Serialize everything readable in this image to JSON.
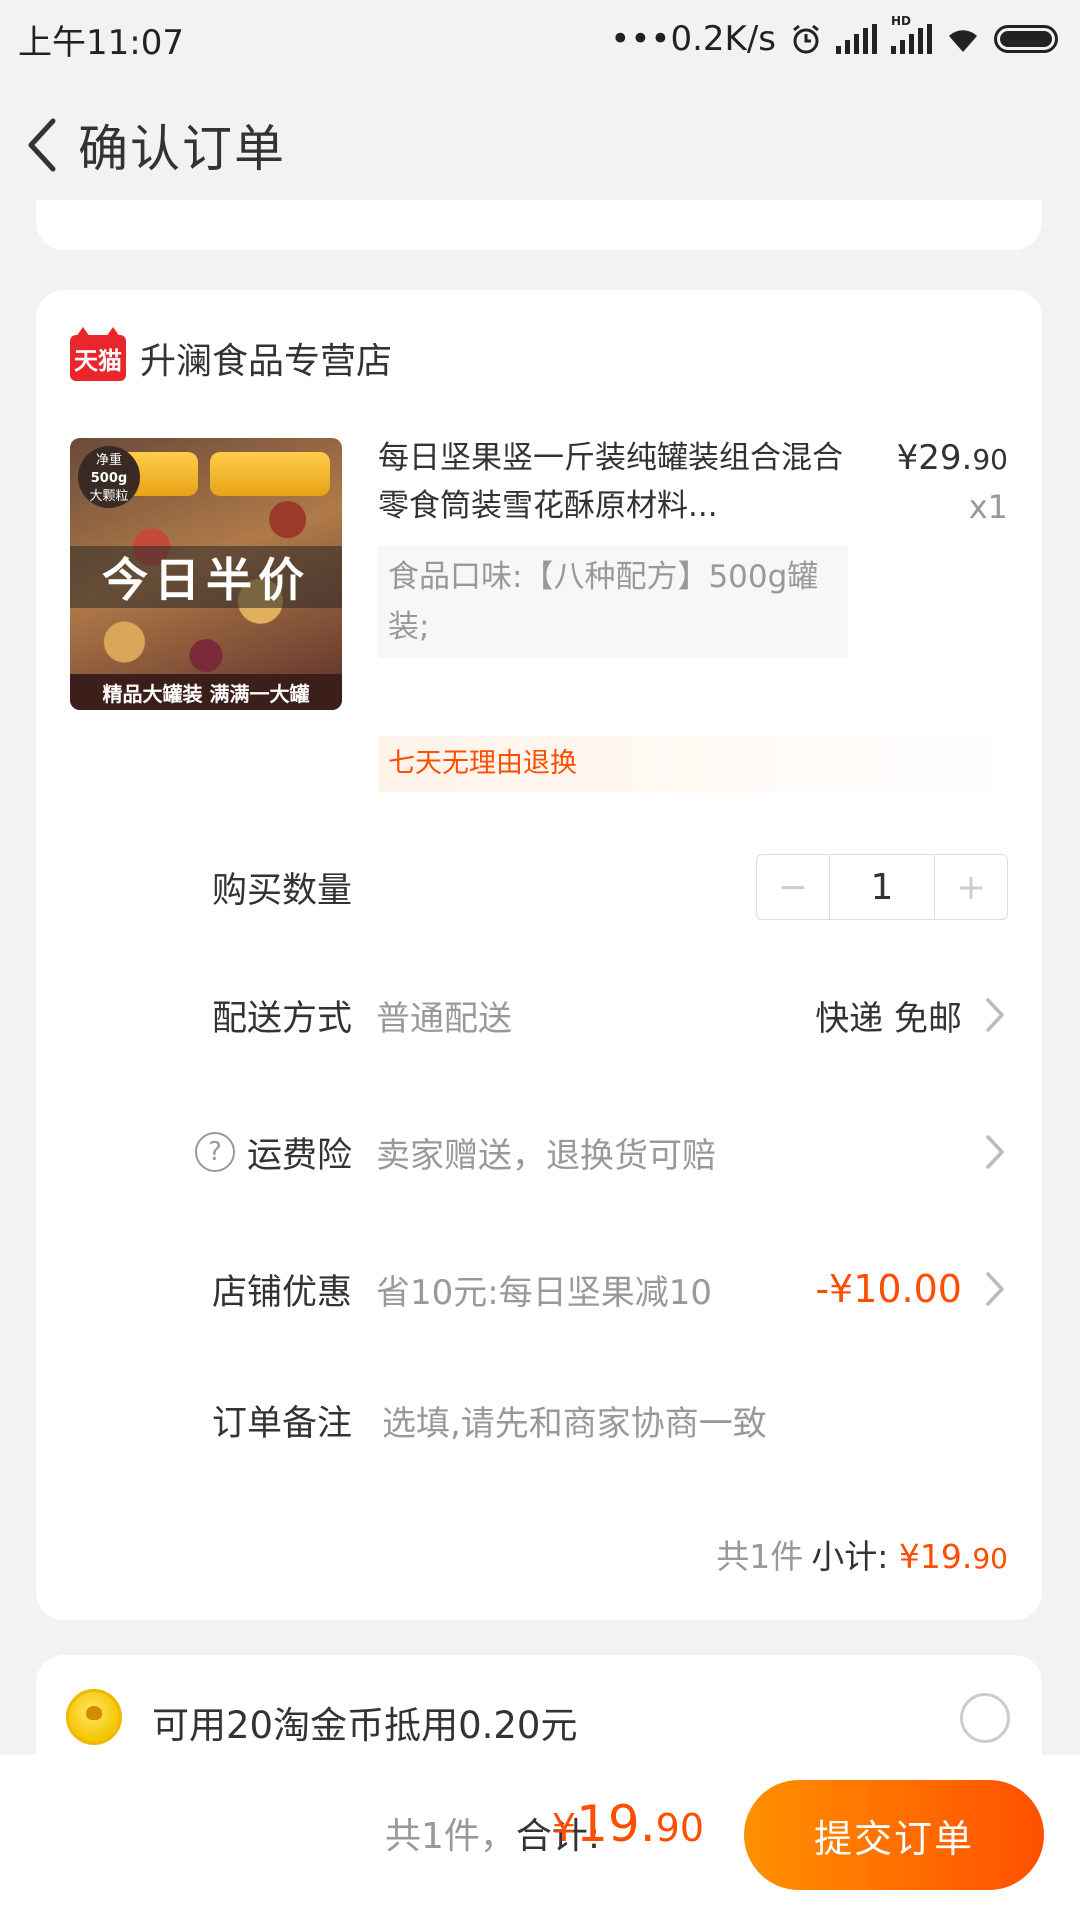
{
  "status_bar": {
    "time": "上午11:07",
    "net_speed": "•••0.2K/s",
    "hd_label": "HD"
  },
  "header": {
    "title": "确认订单"
  },
  "shop": {
    "logo_text": "天猫",
    "name": "升澜食品专营店"
  },
  "product": {
    "image": {
      "badge_line1": "净重",
      "badge_line2": "500g",
      "badge_line3": "大颗粒",
      "banner": "今日半价",
      "footer": "精品大罐装 满满一大罐"
    },
    "title": "每日坚果竖一斤装纯罐装组合混合零食筒装雪花酥原材料...",
    "price_int": "¥29.",
    "price_dec": "90",
    "qty": "x1",
    "sku": "食品口味:【八种配方】500g罐装;",
    "return_tag": "七天无理由退换"
  },
  "quantity": {
    "label": "购买数量",
    "minus": "−",
    "value": "1",
    "plus": "+"
  },
  "delivery": {
    "label": "配送方式",
    "value": "普通配送",
    "right": "快递 免邮"
  },
  "shipping_insurance": {
    "help": "?",
    "label": "运费险",
    "value": "卖家赠送，退换货可赔"
  },
  "shop_discount": {
    "label": "店铺优惠",
    "value": "省10元:每日坚果减10",
    "amount": "-¥10.00"
  },
  "note": {
    "label": "订单备注",
    "placeholder": "选填,请先和商家协商一致"
  },
  "subtotal": {
    "count": "共1件",
    "label": "小计:",
    "amount_int": "¥19.",
    "amount_dec": "90"
  },
  "coins": {
    "text": "可用20淘金币抵用0.20元"
  },
  "bottom_bar": {
    "count": "共1件，",
    "total_label": "合计:",
    "total_yen": "¥",
    "total_int": "19.",
    "total_dec": "90",
    "submit": "提交订单"
  },
  "colors": {
    "accent": "#ff4e00",
    "tmall_red": "#e8262b",
    "submit_start": "#ff9000",
    "submit_end": "#ff5000"
  }
}
